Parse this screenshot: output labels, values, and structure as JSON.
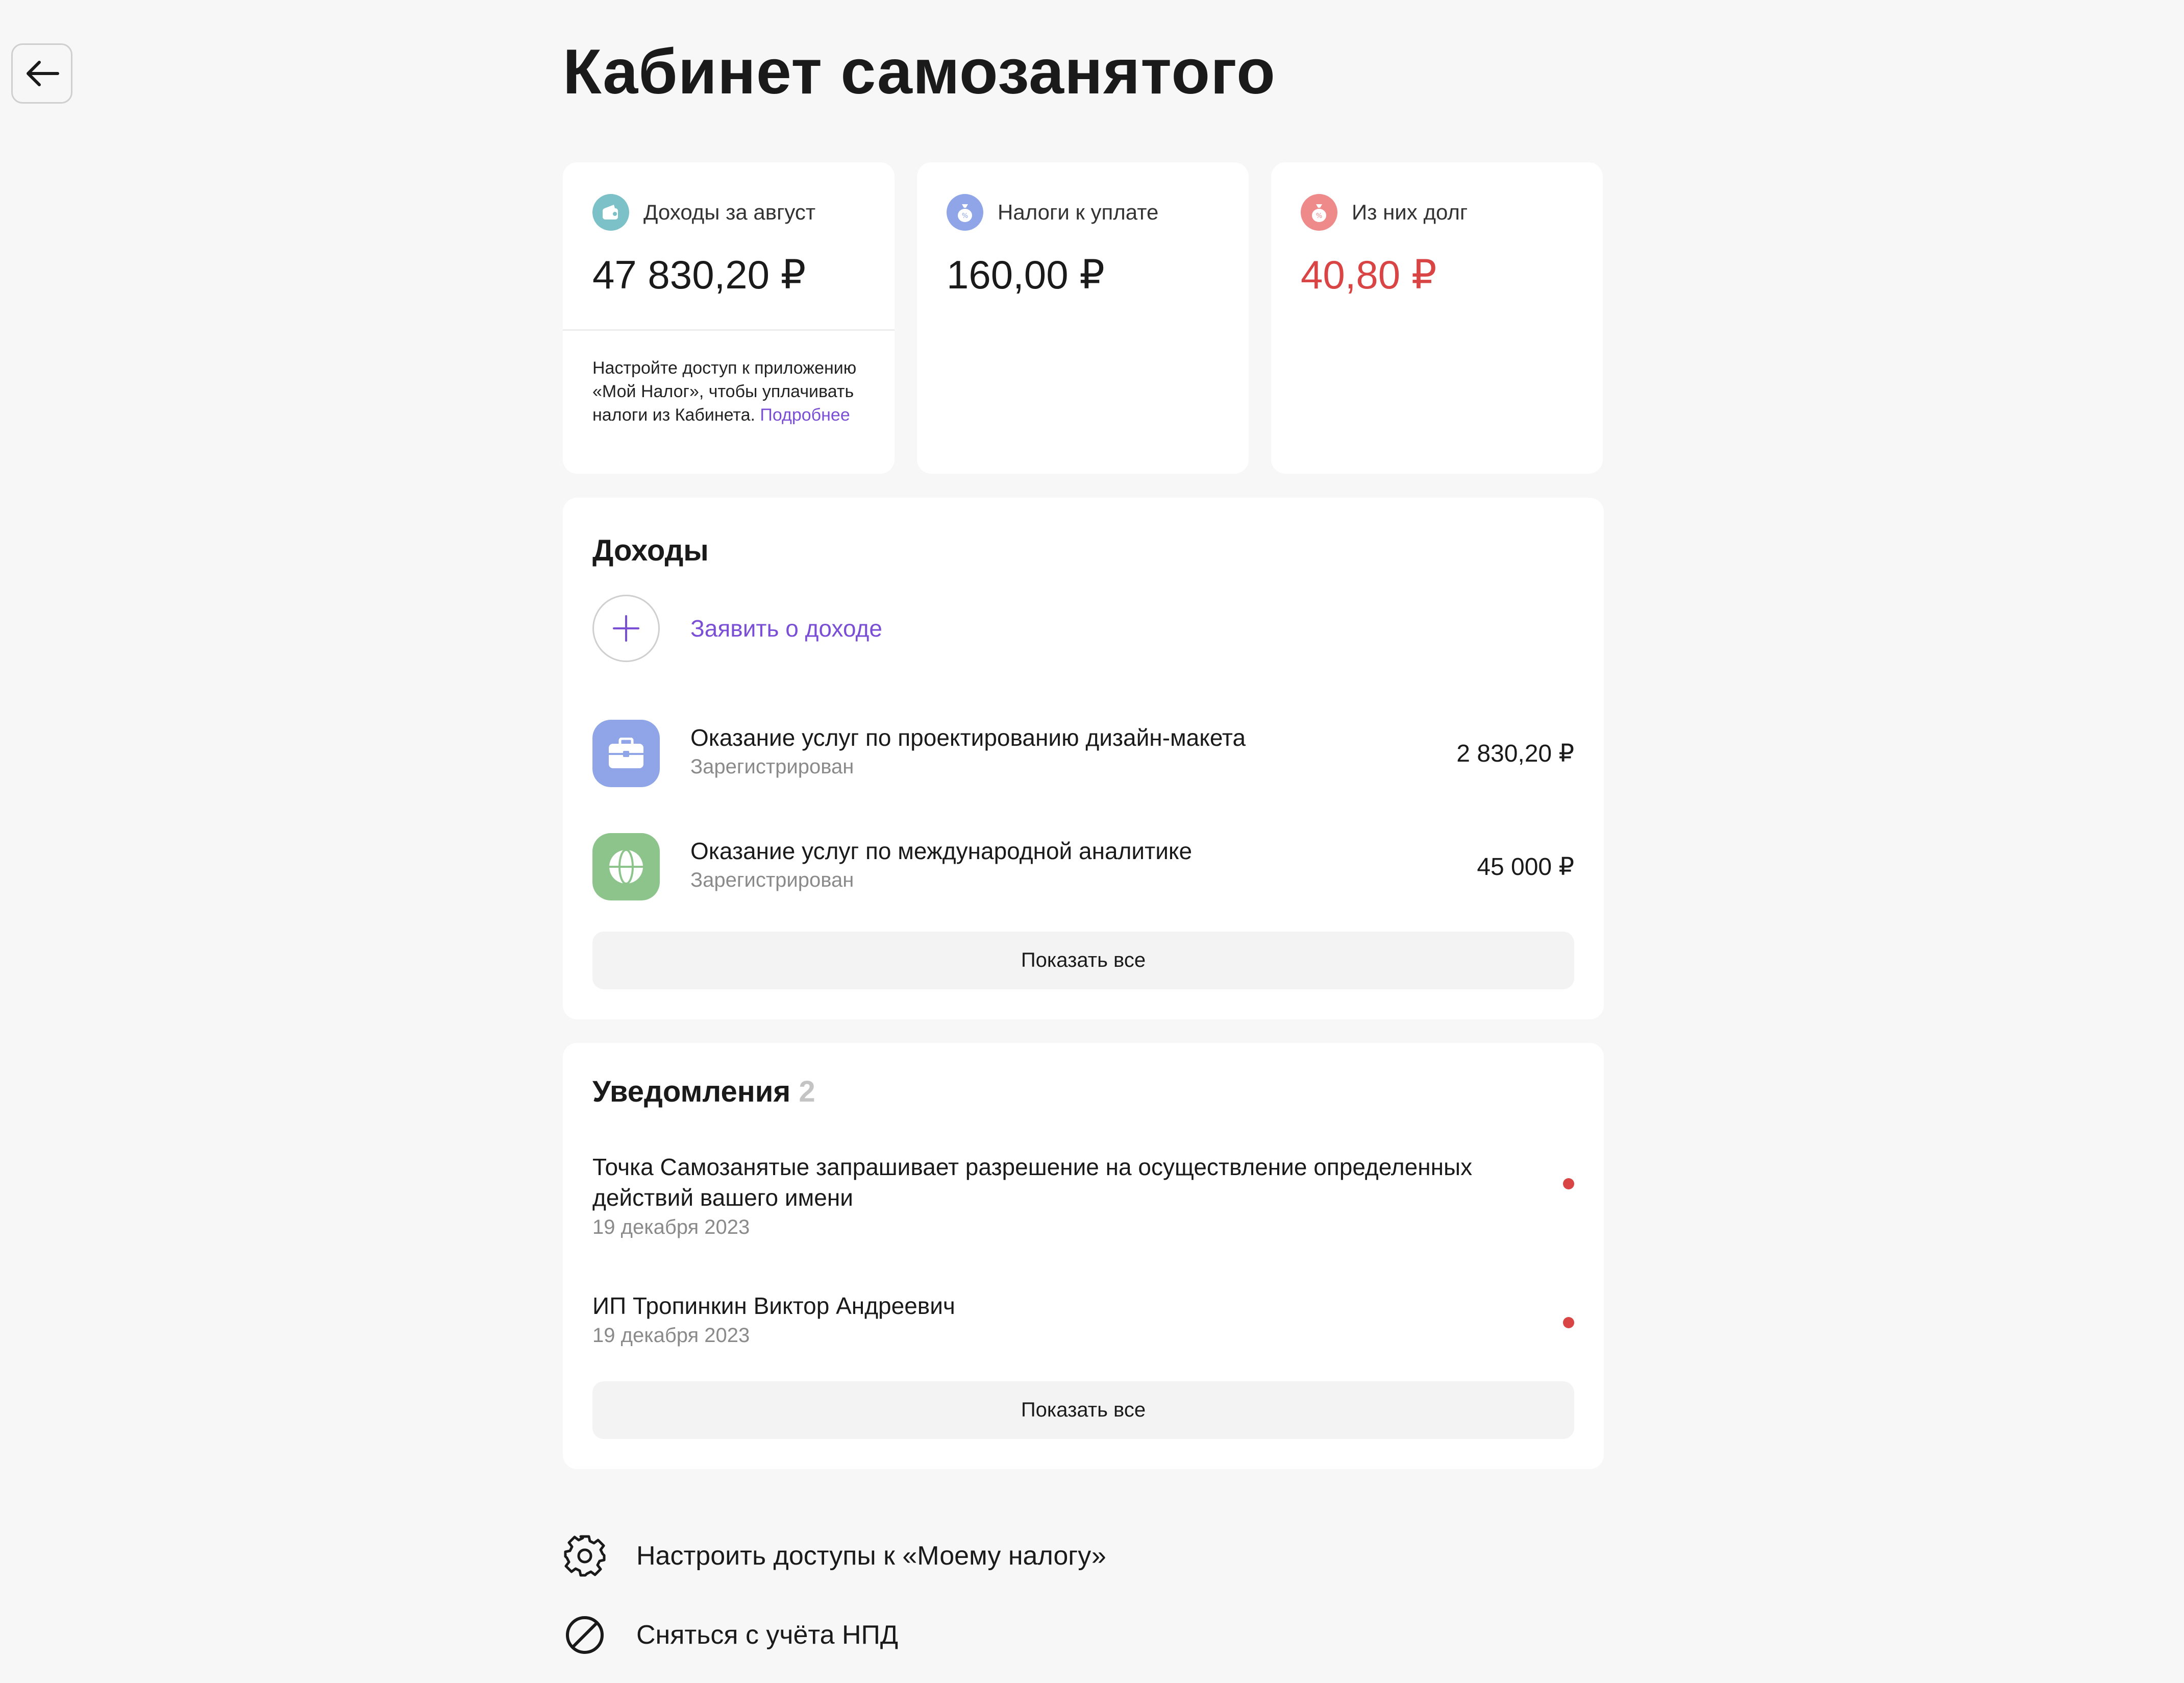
{
  "header": {
    "back_icon": "arrow-left-icon",
    "title": "Кабинет самозанятого"
  },
  "stats": [
    {
      "label": "Доходы за август",
      "value": "47 830,20 ₽",
      "icon": "wallet-icon",
      "icon_color": "#7cc1c8"
    },
    {
      "label": "Налоги к уплате",
      "value": "160,00 ₽",
      "icon": "money-bag-icon",
      "icon_color": "#8fa5e8"
    },
    {
      "label": "Из них долг",
      "value": "40,80 ₽",
      "icon": "money-bag-icon",
      "icon_color": "#ef8a8a",
      "value_color": "#d94545"
    }
  ],
  "stats_note": {
    "text": "Настройте доступ к приложению «Мой Налог», чтобы уплачивать налоги из Кабинета.",
    "link": "Подробнее"
  },
  "income": {
    "title": "Доходы",
    "add_label": "Заявить о доходе",
    "items": [
      {
        "title": "Оказание услуг по проектированию дизайн-макета",
        "status": "Зарегистрирован",
        "amount": "2 830,20 ₽",
        "icon": "briefcase-icon",
        "icon_color": "#8fa5e8"
      },
      {
        "title": "Оказание услуг по международной аналитике",
        "status": "Зарегистрирован",
        "amount": "45 000 ₽",
        "icon": "globe-icon",
        "icon_color": "#8cc48c"
      }
    ],
    "show_all": "Показать все"
  },
  "notifications": {
    "title": "Уведомления",
    "count": "2",
    "items": [
      {
        "title": "Точка Самозанятые запрашивает разрешение на осуществление определенных действий вашего имени",
        "date": "19 декабря 2023"
      },
      {
        "title": "ИП Тропинкин Виктор Андреевич",
        "date": "19 декабря 2023"
      }
    ],
    "show_all": "Показать все"
  },
  "actions": [
    {
      "label": "Настроить доступы к «Моему налогу»",
      "icon": "gear-icon"
    },
    {
      "label": "Сняться с учёта НПД",
      "icon": "block-icon"
    }
  ],
  "colors": {
    "accent": "#7a4fd6",
    "debt": "#d94545",
    "background": "#f7f7f7"
  }
}
